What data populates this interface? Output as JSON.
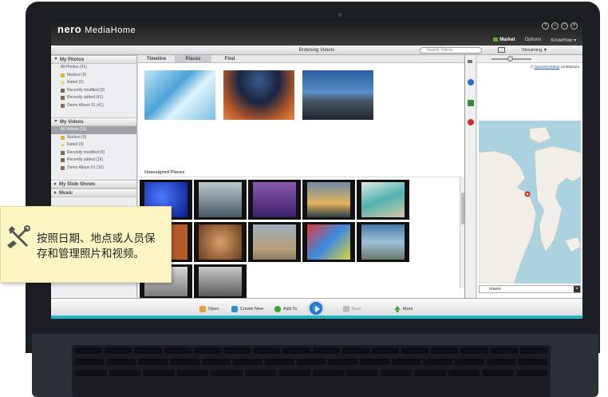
{
  "app": {
    "logo_bold": "nero",
    "logo_rest": "MediaHome",
    "nav": [
      "Market",
      "Options",
      "KnowHow ▾"
    ],
    "window_buttons": [
      "?",
      "–",
      "□",
      "×"
    ]
  },
  "browse_bar": {
    "title": "Browsing Videos",
    "search_placeholder": "Search Videos",
    "streaming_label": "Streaming ▼"
  },
  "sidebar": {
    "photos": {
      "title": "My Photos",
      "items": [
        {
          "label": "All Photos (41)",
          "icon": "none"
        },
        {
          "label": "Marked (0)",
          "icon": "tag-icon"
        },
        {
          "label": "Rated (0)",
          "icon": "star-icon"
        },
        {
          "label": "Recently modified (0)",
          "icon": "clock-icon"
        },
        {
          "label": "Recently added (41)",
          "icon": "clock-icon"
        },
        {
          "label": "Demo Album 01 (41)",
          "icon": "album-icon"
        }
      ]
    },
    "videos": {
      "title": "My Videos",
      "items": [
        {
          "label": "All Videos (16)",
          "icon": "none"
        },
        {
          "label": "Marked (0)",
          "icon": "tag-icon"
        },
        {
          "label": "Rated (0)",
          "icon": "star-icon"
        },
        {
          "label": "Recently modified (0)",
          "icon": "clock-icon"
        },
        {
          "label": "Recently added (16)",
          "icon": "clock-icon"
        },
        {
          "label": "Demo Album 01 (16)",
          "icon": "album-icon"
        }
      ]
    },
    "slideshows_title": "My Slide Shows",
    "music_title": "Music"
  },
  "main": {
    "tabs": [
      "Timeline",
      "Places",
      "Find"
    ],
    "active_tab": "Places",
    "unassigned_label": "Unassigned Places"
  },
  "map": {
    "credit_prefix": "©",
    "credit_link": "OpenStreetMap",
    "credit_suffix": "contributors",
    "search_value": "miami",
    "clear_label": "×"
  },
  "toolbar": {
    "open": "Open",
    "create_new": "Create New",
    "add_to": "Add To",
    "burn": "Burn",
    "more": "More"
  },
  "callout": {
    "line1": "按照日期、地点或人员保",
    "line2": "存和管理照片和视频。"
  },
  "colors": {
    "accent": "#1db6c8",
    "callout_bg": "#fbf6c3",
    "title_bar": "#2a2a2a",
    "selected_item": "#9fa3a6"
  }
}
